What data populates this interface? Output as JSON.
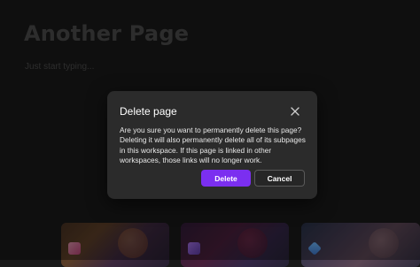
{
  "page": {
    "title": "Another Page",
    "placeholder": "Just start typing..."
  },
  "template_cards": [
    {
      "name": "template-card-1"
    },
    {
      "name": "template-card-2"
    },
    {
      "name": "template-card-3"
    }
  ],
  "dialog": {
    "title": "Delete page",
    "message": "Are you sure you want to permanently delete this page? Deleting it will also permanently delete all of its subpages in this workspace. If this page is linked in other workspaces, those links will no longer work.",
    "delete_label": "Delete",
    "cancel_label": "Cancel",
    "close_icon": "close-icon"
  },
  "colors": {
    "background": "#191919",
    "dialog_bg": "#2b2b2b",
    "primary_button": "#7b2ff0",
    "muted_text": "#4a4a4a"
  }
}
